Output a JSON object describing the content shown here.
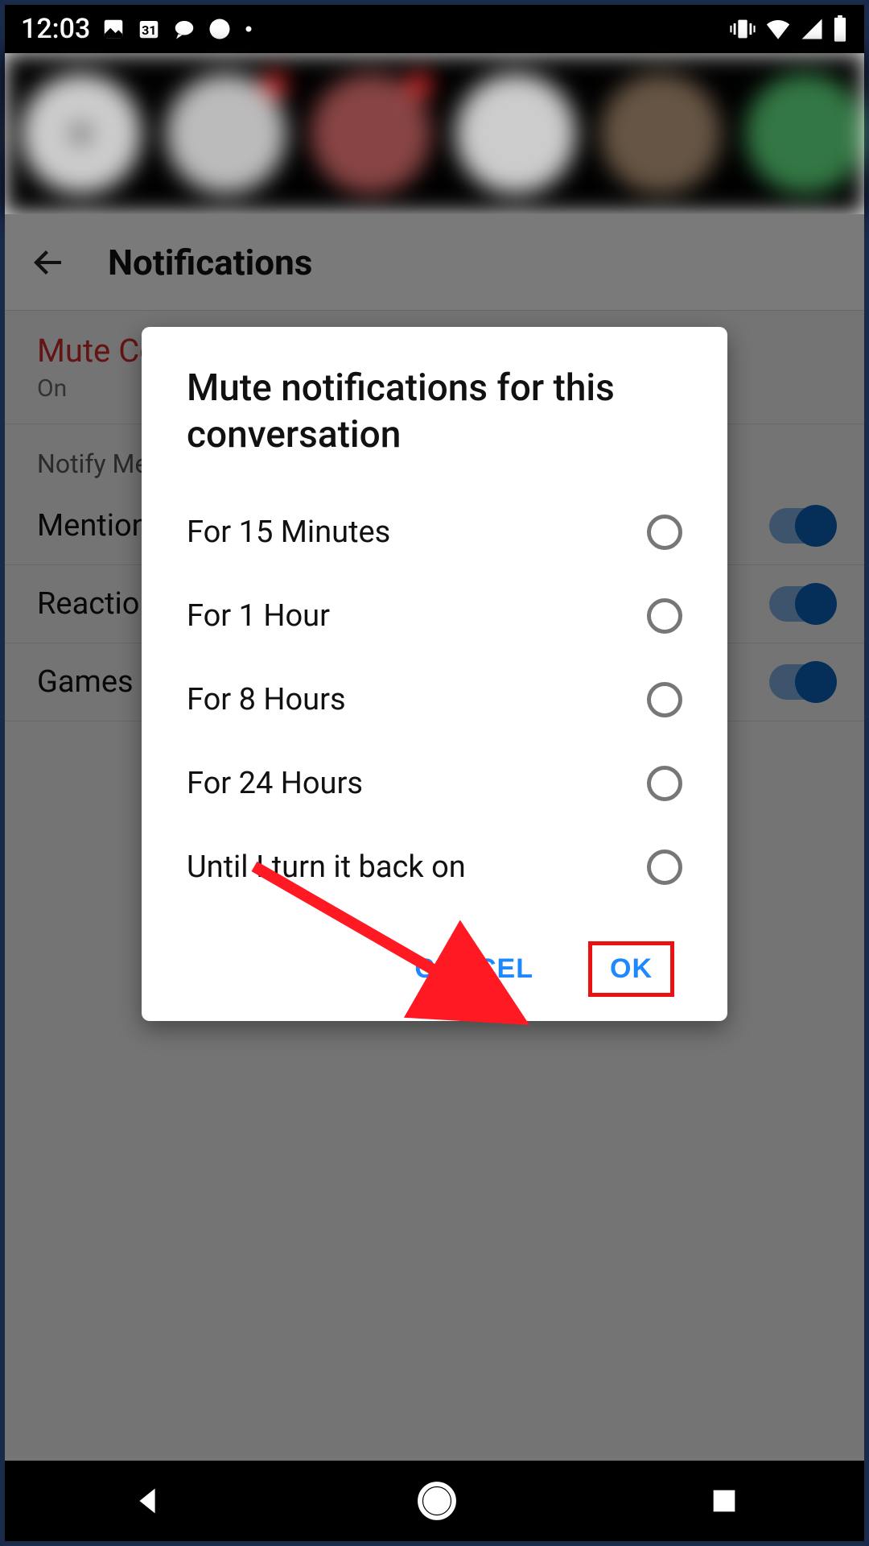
{
  "status": {
    "time": "12:03",
    "calendar_day": "31"
  },
  "page": {
    "title": "Notifications",
    "mute_title": "Mute Conversation",
    "mute_state": "On",
    "section_header": "Notify Me About",
    "items": [
      {
        "label": "Mentions",
        "toggle": true
      },
      {
        "label": "Reactions",
        "toggle": true
      },
      {
        "label": "Games",
        "toggle": true
      }
    ]
  },
  "dialog": {
    "title": "Mute notifications for this conversation",
    "options": [
      "For 15 Minutes",
      "For 1 Hour",
      "For 8 Hours",
      "For 24 Hours",
      "Until I turn it back on"
    ],
    "cancel": "CANCEL",
    "ok": "OK"
  },
  "annotation": {
    "highlight_target": "ok-button",
    "color": "#e81212"
  }
}
